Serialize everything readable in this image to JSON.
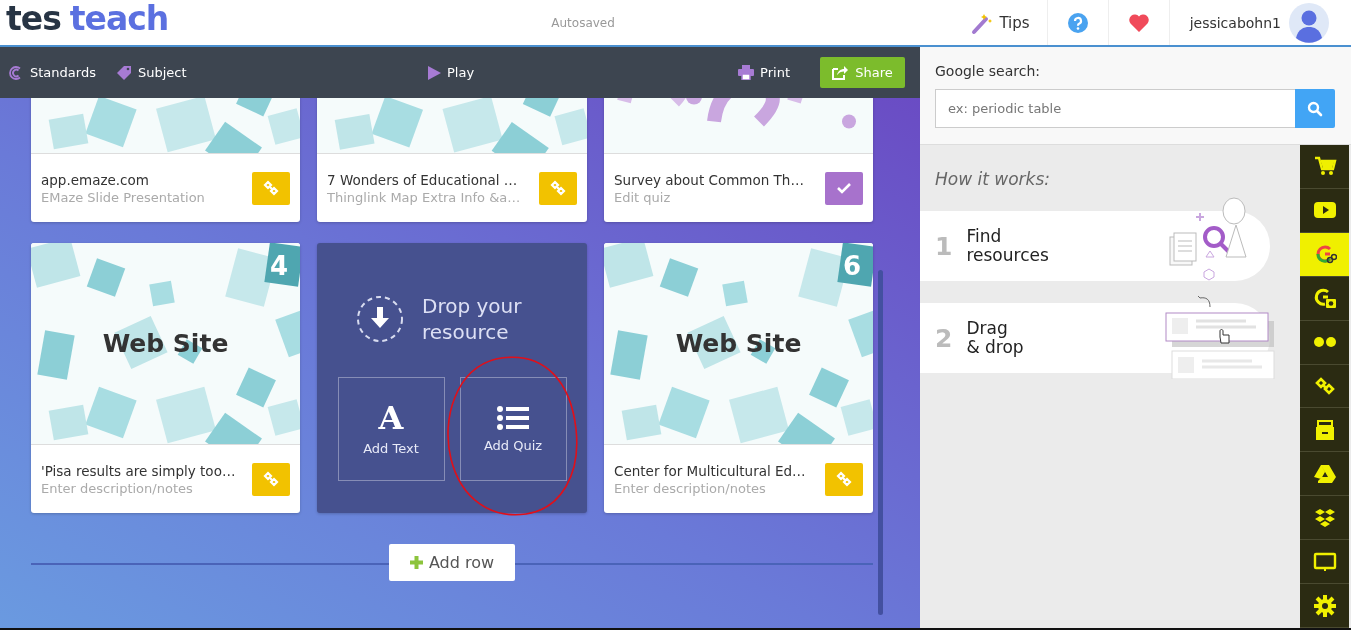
{
  "header": {
    "logo": {
      "first": "tes",
      "second": "teach"
    },
    "status": "Autosaved",
    "nav": [
      {
        "kind": "tips",
        "label": "Tips"
      },
      {
        "kind": "help"
      },
      {
        "kind": "favorites"
      }
    ],
    "user": {
      "name": "jessicabohn1"
    }
  },
  "toolbar": {
    "left": [
      {
        "kind": "standards",
        "label": "Standards"
      },
      {
        "kind": "subject",
        "label": "Subject"
      }
    ],
    "play": "Play",
    "print": "Print",
    "share": "Share"
  },
  "board": {
    "rows": [
      [
        {
          "kind": "resource",
          "thumbnail": {
            "kind": "squares"
          },
          "title": "app.emaze.com",
          "subtitle": "EMaze Slide Presentation",
          "badge": {
            "kind": "link"
          }
        },
        {
          "kind": "resource",
          "thumbnail": {
            "kind": "squares"
          },
          "title": "7 Wonders of Educational …",
          "subtitle": "Thinglink Map Extra Info &a…",
          "badge": {
            "kind": "link"
          }
        },
        {
          "kind": "resource",
          "thumbnail": {
            "kind": "questions"
          },
          "title": "Survey about Common Th…",
          "subtitle": "Edit quiz",
          "badge": {
            "kind": "check"
          }
        }
      ],
      [
        {
          "kind": "resource",
          "thumbnail": {
            "kind": "squares"
          },
          "heading": "Web Site",
          "number": "4",
          "title": "'Pisa results are simply too…",
          "subtitle": "Enter description/notes",
          "badge": {
            "kind": "link"
          }
        },
        {
          "kind": "drop",
          "title": "Drop your resource",
          "actions": [
            {
              "kind": "text",
              "glyph": "A",
              "label": "Add Text",
              "circled": false
            },
            {
              "kind": "quiz",
              "label": "Add Quiz",
              "circled": true
            }
          ]
        },
        {
          "kind": "resource",
          "thumbnail": {
            "kind": "squares"
          },
          "heading": "Web Site",
          "number": "6",
          "title": "Center for Multicultural Ed…",
          "subtitle": "Enter description/notes",
          "badge": {
            "kind": "link"
          }
        }
      ]
    ],
    "add_row": "Add row"
  },
  "search": {
    "label": "Google search:",
    "placeholder": "ex: periodic table"
  },
  "how_it_works": {
    "title": "How it works:",
    "steps": [
      {
        "number": "1",
        "lines": [
          "Find",
          "resources"
        ],
        "kind": "find"
      },
      {
        "number": "2",
        "lines": [
          "Drag",
          "& drop"
        ],
        "kind": "drag"
      }
    ]
  },
  "rail": [
    {
      "kind": "cart",
      "selected": false
    },
    {
      "kind": "video",
      "selected": false
    },
    {
      "kind": "google-link",
      "selected": true
    },
    {
      "kind": "google-image",
      "selected": false
    },
    {
      "kind": "dots",
      "selected": false
    },
    {
      "kind": "link",
      "selected": false
    },
    {
      "kind": "archive",
      "selected": false
    },
    {
      "kind": "drive",
      "selected": false
    },
    {
      "kind": "dropbox",
      "selected": false
    },
    {
      "kind": "screen",
      "selected": false
    },
    {
      "kind": "settings",
      "selected": false
    }
  ]
}
